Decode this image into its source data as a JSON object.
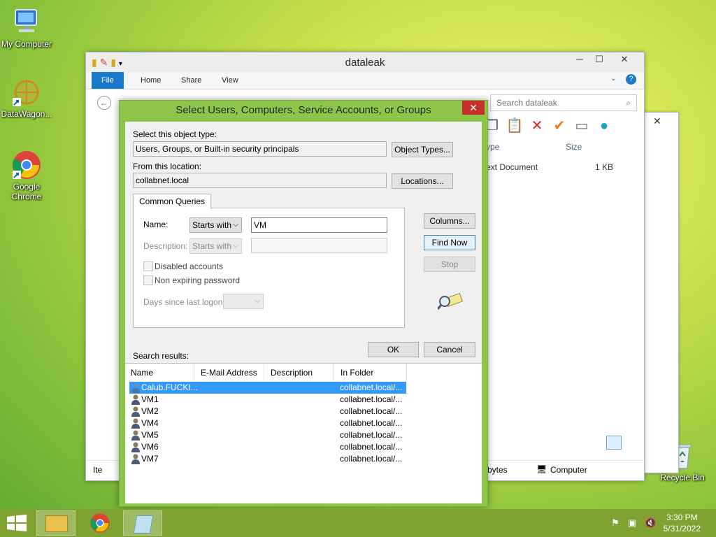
{
  "desktop": {
    "icons": [
      {
        "label": "My Computer"
      },
      {
        "label": "DataWagon..."
      },
      {
        "label": "Google Chrome"
      },
      {
        "label": "Recycle Bin"
      }
    ]
  },
  "explorer": {
    "title": "dataleak",
    "tabs": [
      "File",
      "Home",
      "Share",
      "View"
    ],
    "search_placeholder": "Search dataleak",
    "columns": [
      "ype",
      "Size"
    ],
    "rows": [
      {
        "type": "ext Document",
        "size": "1 KB"
      }
    ],
    "status_left": "Ite",
    "status_size": "bytes",
    "status_location": "Computer"
  },
  "dialog": {
    "title": "Select Users, Computers, Service Accounts, or Groups",
    "object_type_label": "Select this object type:",
    "object_type_value": "Users, Groups, or Built-in security principals",
    "object_types_button": "Object Types...",
    "location_label": "From this location:",
    "location_value": "collabnet.local",
    "locations_button": "Locations...",
    "tab_label": "Common Queries",
    "name_label": "Name:",
    "name_mode": "Starts with",
    "name_value": "VM",
    "description_label": "Description:",
    "description_mode": "Starts with",
    "description_value": "",
    "disabled_accounts_label": "Disabled accounts",
    "non_expiring_label": "Non expiring password",
    "days_label": "Days since last logon:",
    "columns_button": "Columns...",
    "find_now_button": "Find Now",
    "stop_button": "Stop",
    "ok_button": "OK",
    "cancel_button": "Cancel",
    "search_results_label": "Search results:",
    "result_columns": [
      "Name",
      "E-Mail Address",
      "Description",
      "In Folder"
    ],
    "results": [
      {
        "name": "Calub.FUCKI...",
        "folder": "collabnet.local/..."
      },
      {
        "name": "VM1",
        "folder": "collabnet.local/..."
      },
      {
        "name": "VM2",
        "folder": "collabnet.local/..."
      },
      {
        "name": "VM4",
        "folder": "collabnet.local/..."
      },
      {
        "name": "VM5",
        "folder": "collabnet.local/..."
      },
      {
        "name": "VM6",
        "folder": "collabnet.local/..."
      },
      {
        "name": "VM7",
        "folder": "collabnet.local/..."
      }
    ]
  },
  "taskbar": {
    "time": "3:30 PM",
    "date": "5/31/2022"
  },
  "colors": {
    "dialog_frame": "#8dc54a",
    "selection": "#3399ff",
    "file_tab": "#1979ca",
    "taskbar": "#7fa331"
  }
}
